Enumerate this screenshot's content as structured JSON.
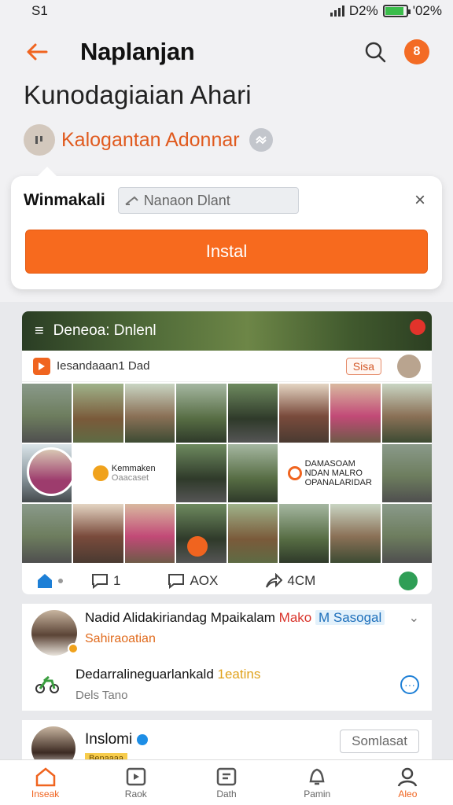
{
  "status": {
    "left": "S1",
    "battery_text": "D2%",
    "right_text": "'02%"
  },
  "header": {
    "title": "Naplanjan"
  },
  "page": {
    "title": "Kunodagiaian Ahari",
    "subtitle": "Kalogantan Adonnar"
  },
  "install_card": {
    "label": "Winmakali",
    "field_value": "Nanaon Dlant",
    "button_label": "Instal"
  },
  "post": {
    "title": "Deneoa: Dnlenl",
    "sub_label": "Iesandaaan1 Dad",
    "sisa_label": "Sisa",
    "promo1": [
      "Kemmaken",
      "Oaacaset"
    ],
    "promo2": [
      "DAMASOAM",
      "NDAN MALRO",
      "OPANALARIDAR"
    ],
    "actions": {
      "comments": "1",
      "replies": "AOX",
      "shares": "4CM"
    }
  },
  "list": {
    "item1": {
      "name": "Nadid Alidakiriandag Mpaikalam",
      "highlight": "Mako",
      "tag": "M Sasogal",
      "sub": "Sahiraoatian"
    },
    "item2": {
      "title": "Dedarralineguarlankald",
      "extra": "1eatins",
      "sub": "Dels Tano"
    },
    "item3": {
      "name": "Inslomi",
      "button": "Somlasat",
      "tag": "Benaaaa"
    }
  },
  "nav": {
    "items": [
      {
        "label": "Inseak"
      },
      {
        "label": "Raok"
      },
      {
        "label": "Dath"
      },
      {
        "label": "Pamin"
      },
      {
        "label": "Aleo"
      }
    ]
  },
  "colors": {
    "accent": "#f76a1e",
    "link_blue": "#1d6fbb"
  },
  "icons": [
    "back-arrow-icon",
    "search-icon",
    "menu-icon",
    "play-icon",
    "home-icon",
    "comment-icon",
    "share-icon",
    "motorcycle-icon",
    "more-icon",
    "verified-icon",
    "profile-icon"
  ]
}
